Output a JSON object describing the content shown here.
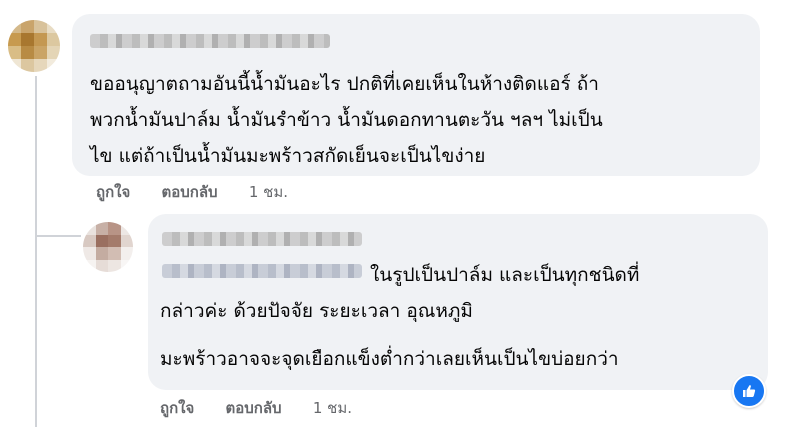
{
  "comment1": {
    "lines": [
      "ขออนุญาตถามอันนี้น้ำมันอะไร ปกติที่เคยเห็นในห้างติดแอร์ ถ้า",
      "พวกน้ำมันปาล์ม น้ำมันรำข้าว น้ำมันดอกทานตะวัน ฯลฯ ไม่เป็น",
      "ไข แต่ถ้าเป็นน้ำมันมะพร้าวสกัดเย็นจะเป็นไขง่าย"
    ],
    "like_label": "ถูกใจ",
    "reply_label": "ตอบกลับ",
    "time": "1 ชม."
  },
  "reply1": {
    "line1": "ในรูปเป็นปาล์ม และเป็นทุกชนิดที่",
    "line2": "กล่าวค่ะ ด้วยปัจจัย ระยะเวลา อุณหภูมิ",
    "line3": "มะพร้าวอาจจะจุดเยือกแข็งต่ำกว่าเลยเห็นเป็นไขบ่อยกว่า",
    "like_label": "ถูกใจ",
    "reply_label": "ตอบกลับ",
    "time": "1 ชม.",
    "reaction_icon": "thumbs-up-icon",
    "reaction_color": "#1877f2"
  }
}
